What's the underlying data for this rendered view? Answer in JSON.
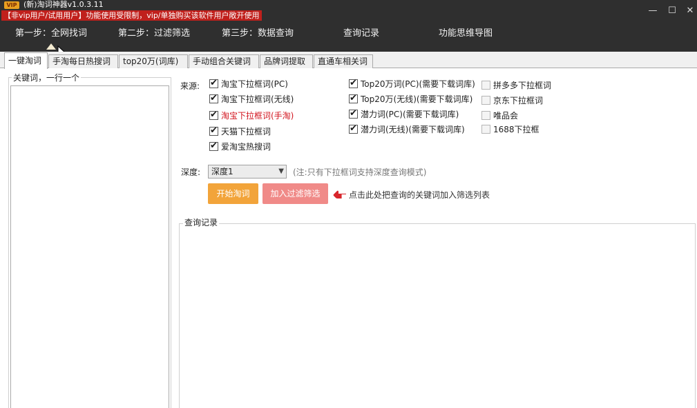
{
  "app": {
    "badge": "VIP",
    "title": "(新)淘词神器v1.0.3.11",
    "notice": "【非vip用户/试用用户】功能使用受限制，vip/单独购买该软件用户敞开使用"
  },
  "window_controls": {
    "minimize": "—",
    "maximize": "☐",
    "close": "✕"
  },
  "nav": [
    "第一步：全网找词",
    "第二步：过滤筛选",
    "第三步：数据查询",
    "查询记录",
    "功能思维导图"
  ],
  "tabs": [
    "一键淘词",
    "手淘每日热搜词",
    "top20万(词库)",
    "手动组合关键词",
    "品牌词提取",
    "直通车相关词"
  ],
  "keywords": {
    "legend": "关键词，一行一个",
    "value": ""
  },
  "sources": {
    "label": "来源:",
    "col1": [
      {
        "label": "淘宝下拉框词(PC)",
        "checked": true
      },
      {
        "label": "淘宝下拉框词(无线)",
        "checked": true
      },
      {
        "label": "淘宝下拉框词(手淘)",
        "checked": true,
        "color": "red"
      },
      {
        "label": "天猫下拉框词",
        "checked": true
      },
      {
        "label": "爱淘宝热搜词",
        "checked": true
      }
    ],
    "col2": [
      {
        "label": "Top20万词(PC)(需要下载词库)",
        "checked": true
      },
      {
        "label": "Top20万(无线)(需要下载词库)",
        "checked": true
      },
      {
        "label": "潜力词(PC)(需要下载词库)",
        "checked": true
      },
      {
        "label": "潜力词(无线)(需要下载词库)",
        "checked": true
      }
    ],
    "col3": [
      {
        "label": "拼多多下拉框词",
        "checked": false
      },
      {
        "label": "京东下拉框词",
        "checked": false
      },
      {
        "label": "唯品会",
        "checked": false
      },
      {
        "label": "1688下拉框",
        "checked": false
      }
    ]
  },
  "depth": {
    "label": "深度:",
    "selected": "深度1",
    "note": "(注:只有下拉框词支持深度查询模式)"
  },
  "buttons": {
    "start": "开始淘词",
    "add_filter": "加入过滤筛选"
  },
  "hint": "点击此处把查询的关键词加入筛选列表",
  "history": {
    "legend": "查询记录"
  }
}
